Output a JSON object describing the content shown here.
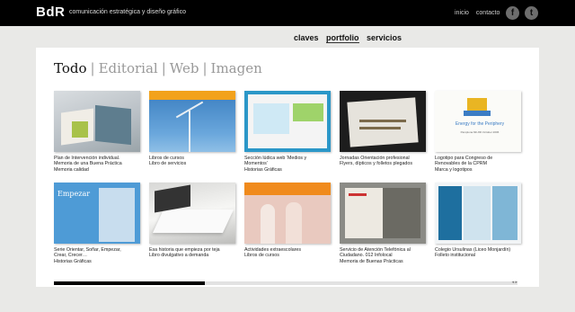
{
  "header": {
    "logo": "BdR",
    "tagline": "comunicación estratégica y diseño gráfico",
    "links": [
      "inicio",
      "contacto"
    ],
    "social": [
      {
        "icon": "facebook-icon",
        "glyph": "f"
      },
      {
        "icon": "twitter-icon",
        "glyph": "t"
      }
    ]
  },
  "nav": {
    "items": [
      "claves",
      "portfolio",
      "servicios"
    ],
    "active": "portfolio"
  },
  "filters": {
    "items": [
      "Todo",
      "Editorial",
      "Web",
      "Imagen"
    ],
    "active": "Todo"
  },
  "portfolio": {
    "items": [
      {
        "caption": [
          "Plan de Intervención individual.",
          "Memoria de una Buena Práctica",
          "Memoria calidad"
        ]
      },
      {
        "caption": [
          "Libros de cursos",
          "Libro de servicios"
        ]
      },
      {
        "caption": [
          "Sección lúdica web ‘Medios y",
          "Momentos’",
          "Historias Gráficas"
        ]
      },
      {
        "caption": [
          "Jornadas Orientación profesional",
          "Flyers, dípticos y folletos plegados"
        ]
      },
      {
        "caption": [
          "Logotipo para Congreso de",
          "Renovables de la CPRM",
          "Marca y logotipos"
        ],
        "thumb_text": [
          "Energy for the Periphery",
          "Pamplona 6th-8th October 2006"
        ]
      },
      {
        "caption": [
          "Serie Orientar, Soñar, Empezar,",
          "Crear, Crecer…",
          "Historias Gráficas"
        ],
        "thumb_text": [
          "Empezar"
        ]
      },
      {
        "caption": [
          "Esa historia que empieza por teja",
          "Libro divulgativo a demanda"
        ]
      },
      {
        "caption": [
          "Actividades extraescolares",
          "Libros de cursos"
        ]
      },
      {
        "caption": [
          "Servicio de Atención Telefónica al",
          "Ciudadano. 012 Infolocal",
          "Memoria de Buenas Prácticas"
        ]
      },
      {
        "caption": [
          "Colegio Ursulinas (Liceo Monjardín)",
          "Folleto institucional"
        ]
      }
    ]
  },
  "scrollbar": {
    "position_fraction": 0.0,
    "visible_fraction": 0.33,
    "arrows": "◂ ▸"
  },
  "colors": {
    "topbar": "#000000",
    "background": "#e9e9e7",
    "panel": "#ffffff",
    "filter_inactive": "#999999"
  }
}
